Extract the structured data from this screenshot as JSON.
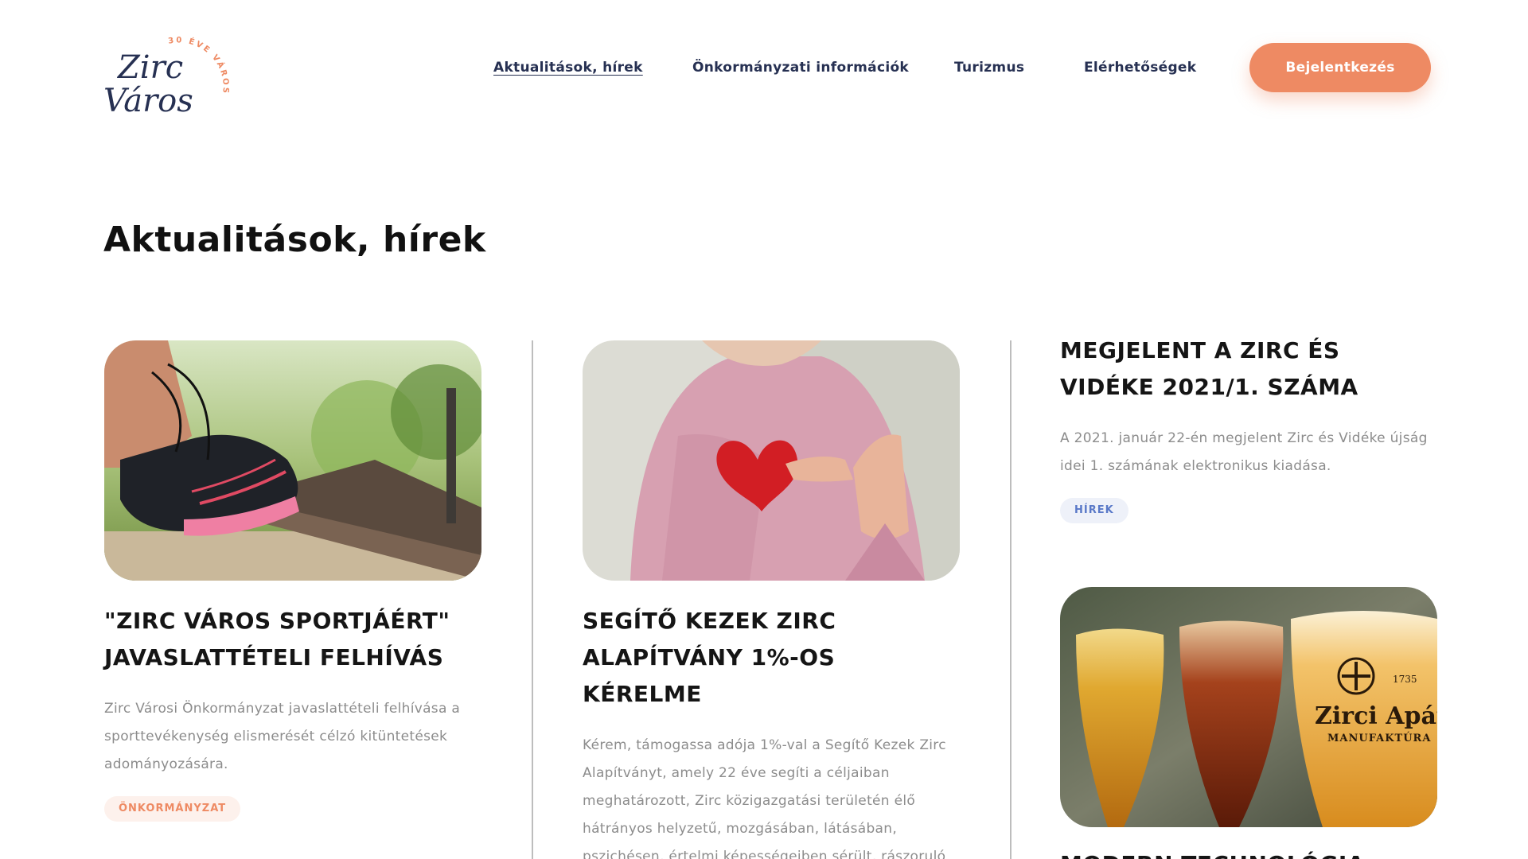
{
  "logo": {
    "line1": "Zirc",
    "line2": "Város",
    "badge": "30 ÉVE VÁROS"
  },
  "nav": {
    "items": [
      {
        "label": "Aktualitások, hírek",
        "active": true
      },
      {
        "label": "Önkormányzati információk"
      },
      {
        "label": "Turizmus"
      },
      {
        "label": "Elérhetőségek"
      }
    ],
    "login_label": "Bejelentkezés"
  },
  "page_title": "Aktualitások, hírek",
  "articles": [
    {
      "title": "\"Zirc Város Sportjáért\" javaslattételi felhívás",
      "text": "Zirc Városi Önkormányzat javaslattételi felhívása a sporttevékenység elismerését célzó kitüntetések adományozására.",
      "tag": "ÖNKORMÁNYZAT",
      "image": "running-shoe-photo"
    },
    {
      "title": "Segítő Kezek Zirc Alapítvány 1%-os kérelme",
      "text": "Kérem, támogassa adója 1%-val a Segítő Kezek Zirc Alapítványt, amely 22 éve segíti a céljaiban meghatározott, Zirc közigazgatási területén élő hátrányos helyzetű, mozgásában, látásában, pszichésen, értelmi képességeiben sérült, rászoruló embereket.",
      "image": "heart-in-hand-photo"
    },
    {
      "title": "Megjelent a Zirc és Vidéke 2021/1. száma",
      "text": "A 2021. január 22-én megjelent Zirc és Vidéke újság idei 1. számának elektronikus kiadása.",
      "tag": "HÍREK"
    },
    {
      "title": "Modern technológia",
      "image": "beer-glasses-photo",
      "glass_label": "Zirci Apátsági",
      "glass_sub": "MANUFAKTÚRA",
      "glass_year": "1735"
    }
  ],
  "colors": {
    "accent": "#ee8a63",
    "navy": "#263052",
    "tag_blue": "#5a79c8"
  }
}
